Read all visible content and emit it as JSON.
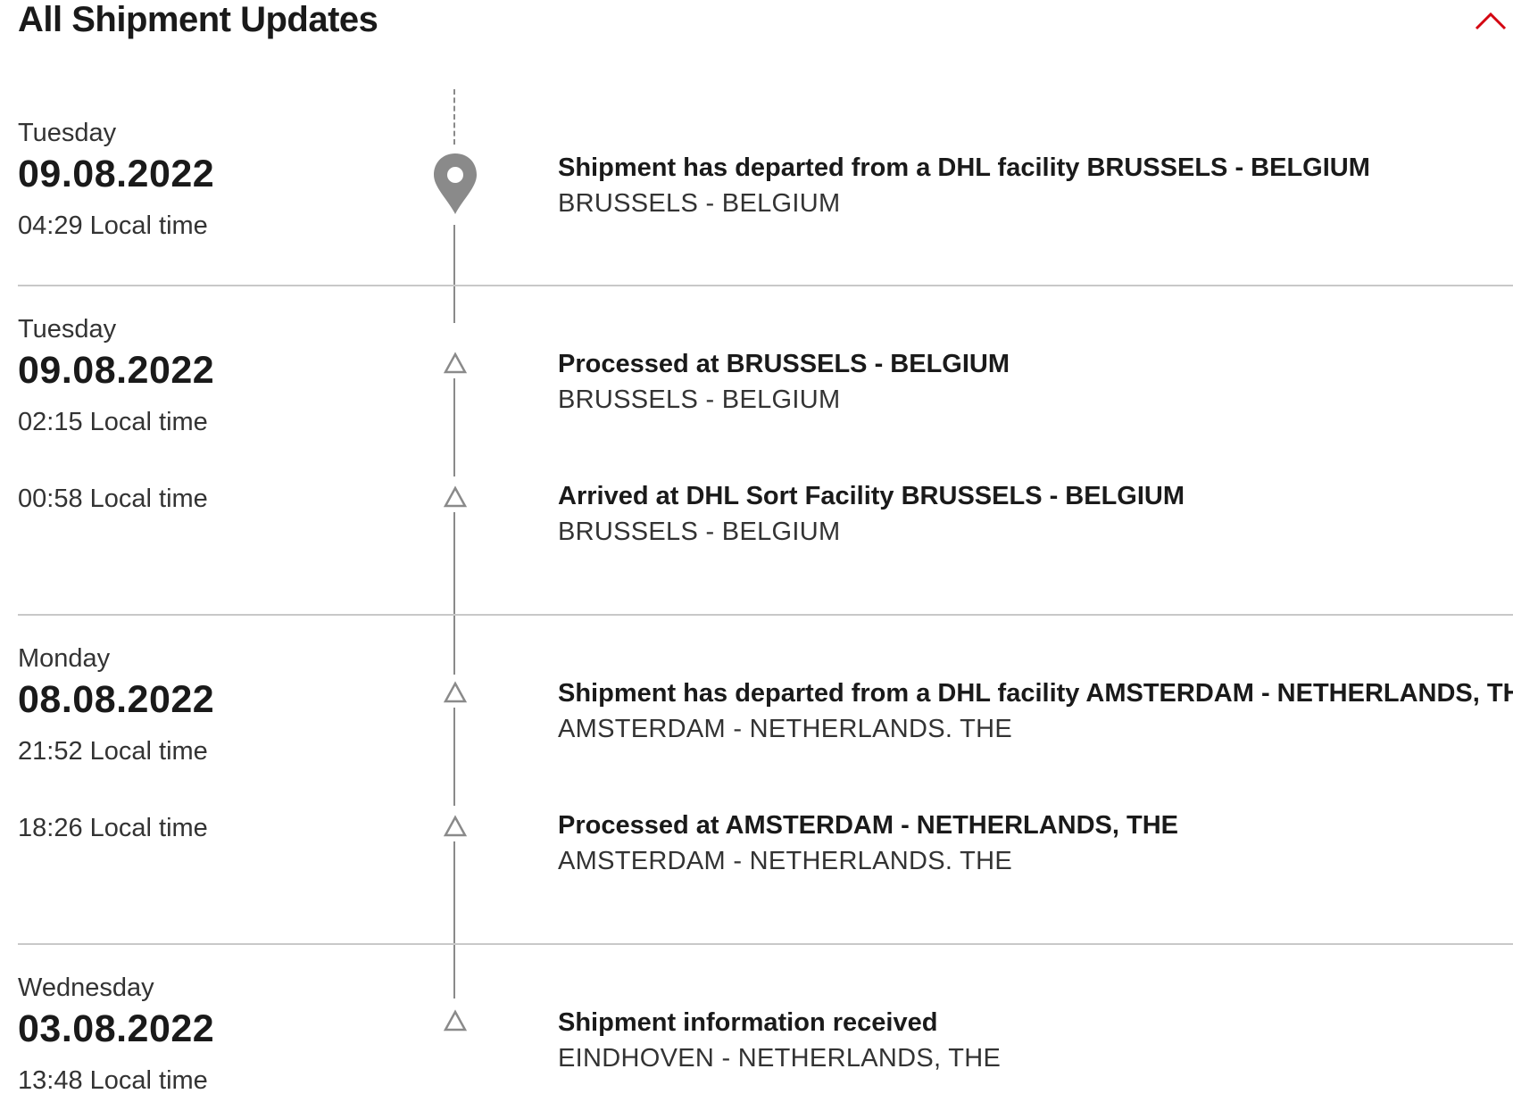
{
  "header": {
    "title": "All Shipment Updates",
    "collapse_icon": "chevron-up-icon",
    "accent_color": "#d40511"
  },
  "groups": [
    {
      "weekday": "Tuesday",
      "date": "09.08.2022",
      "events": [
        {
          "time": "04:29 Local time",
          "description": "Shipment has departed from a DHL facility BRUSSELS - BELGIUM",
          "location": "BRUSSELS - BELGIUM",
          "icon": "location-pin-icon"
        }
      ]
    },
    {
      "weekday": "Tuesday",
      "date": "09.08.2022",
      "events": [
        {
          "time": "02:15 Local time",
          "description": "Processed at BRUSSELS - BELGIUM",
          "location": "BRUSSELS - BELGIUM",
          "icon": "triangle-icon"
        },
        {
          "time": "00:58 Local time",
          "description": "Arrived at DHL Sort Facility BRUSSELS - BELGIUM",
          "location": "BRUSSELS - BELGIUM",
          "icon": "triangle-icon"
        }
      ]
    },
    {
      "weekday": "Monday",
      "date": "08.08.2022",
      "events": [
        {
          "time": "21:52 Local time",
          "description": "Shipment has departed from a DHL facility AMSTERDAM - NETHERLANDS, THE",
          "location": "AMSTERDAM - NETHERLANDS. THE",
          "icon": "triangle-icon"
        },
        {
          "time": "18:26 Local time",
          "description": "Processed at AMSTERDAM - NETHERLANDS, THE",
          "location": "AMSTERDAM - NETHERLANDS. THE",
          "icon": "triangle-icon"
        }
      ]
    },
    {
      "weekday": "Wednesday",
      "date": "03.08.2022",
      "events": [
        {
          "time": "13:48 Local time",
          "description": "Shipment information received",
          "location": "EINDHOVEN - NETHERLANDS, THE",
          "icon": "triangle-icon"
        }
      ]
    }
  ]
}
